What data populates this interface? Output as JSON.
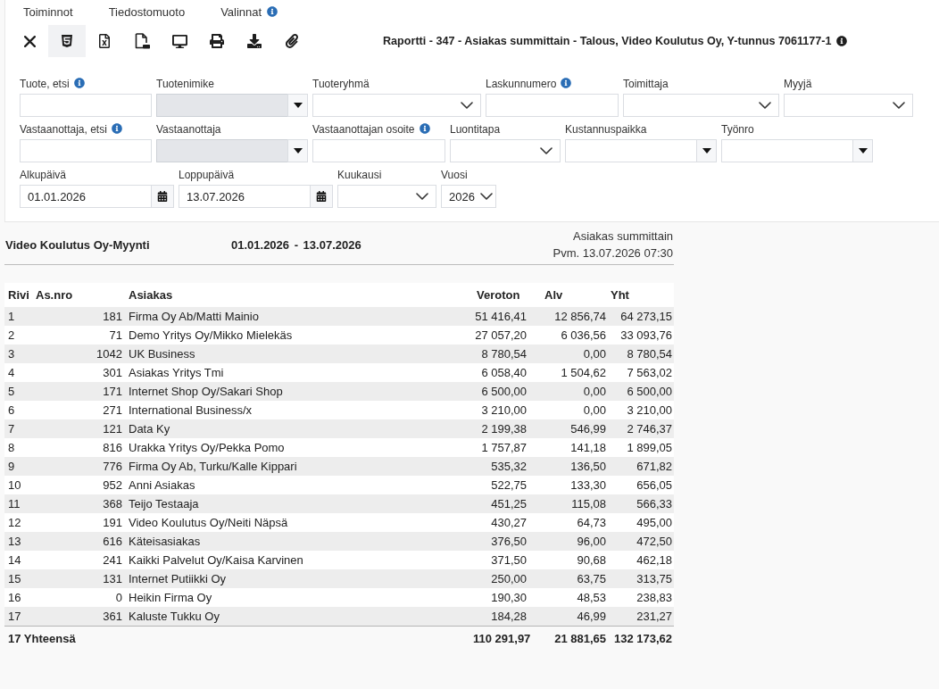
{
  "menu": [
    {
      "label": "Toiminnot",
      "info": false
    },
    {
      "label": "Tiedostomuoto",
      "info": false
    },
    {
      "label": "Valinnat",
      "info": true
    }
  ],
  "toolbar": [
    {
      "kind": "close",
      "selected": false
    },
    {
      "kind": "html",
      "selected": true
    },
    {
      "kind": "excel",
      "selected": false
    },
    {
      "kind": "pdf",
      "selected": false
    },
    {
      "kind": "screen",
      "selected": false
    },
    {
      "kind": "print",
      "selected": false
    },
    {
      "kind": "download",
      "selected": false
    },
    {
      "kind": "attach",
      "selected": false
    }
  ],
  "report_title": {
    "text": "Raportti - 347 - Asiakas summittain - Talous, Video Koulutus Oy, Y-tunnus 7061177-1",
    "info": true
  },
  "filters": [
    [
      {
        "label": "Tuote, etsi",
        "kind": "text",
        "info": true,
        "disabled": false
      },
      {
        "label": "Tuotenimike",
        "kind": "combo",
        "info": false,
        "disabled": true
      },
      {
        "label": "Tuoteryhmä",
        "kind": "select",
        "info": false,
        "disabled": false
      },
      {
        "label": "Laskunnumero",
        "kind": "text",
        "info": true,
        "disabled": false
      },
      {
        "label": "Toimittaja",
        "kind": "select",
        "info": false,
        "disabled": false
      },
      {
        "label": "Myyjä",
        "kind": "select",
        "info": false,
        "disabled": false
      }
    ],
    [
      {
        "label": "Vastaanottaja, etsi",
        "kind": "text",
        "info": true,
        "disabled": false
      },
      {
        "label": "Vastaanottaja",
        "kind": "combo",
        "info": false,
        "disabled": true
      },
      {
        "label": "Vastaanottajan osoite",
        "kind": "text",
        "info": true,
        "disabled": false
      },
      {
        "label": "Luontitapa",
        "kind": "select",
        "info": false,
        "disabled": false
      },
      {
        "label": "Kustannuspaikka",
        "kind": "combo",
        "info": false,
        "disabled": false
      },
      {
        "label": "Työnro",
        "kind": "combo",
        "info": false,
        "disabled": false
      }
    ],
    [
      {
        "label": "Alkupäivä",
        "kind": "date",
        "info": false,
        "disabled": false,
        "value": "01.01.2026"
      },
      {
        "label": "Loppupäivä",
        "kind": "date",
        "info": false,
        "disabled": false,
        "value": "13.07.2026"
      },
      {
        "label": "Kuukausi",
        "kind": "select",
        "info": false,
        "disabled": false
      },
      {
        "label": "Vuosi",
        "kind": "select",
        "info": false,
        "disabled": false,
        "value": "2026"
      }
    ]
  ],
  "report_header": {
    "company": "Video Koulutus Oy-Myynti",
    "period": "01.01.2026 - 13.07.2026",
    "report_type": "Asiakas summittain",
    "printed": "Pvm. 13.07.2026 07:30"
  },
  "table": {
    "columns": [
      "Rivi",
      "As.nro",
      "Asiakas",
      "Veroton",
      "Alv",
      "Yht"
    ],
    "rows": [
      [
        "1",
        "181",
        "Firma Oy Ab/Matti Mainio",
        "51 416,41",
        "12 856,74",
        "64 273,15"
      ],
      [
        "2",
        "71",
        "Demo Yritys Oy/Mikko Mielekäs",
        "27 057,20",
        "6 036,56",
        "33 093,76"
      ],
      [
        "3",
        "1042",
        "UK Business",
        "8 780,54",
        "0,00",
        "8 780,54"
      ],
      [
        "4",
        "301",
        "Asiakas Yritys Tmi",
        "6 058,40",
        "1 504,62",
        "7 563,02"
      ],
      [
        "5",
        "171",
        "Internet Shop Oy/Sakari Shop",
        "6 500,00",
        "0,00",
        "6 500,00"
      ],
      [
        "6",
        "271",
        "International Business/x",
        "3 210,00",
        "0,00",
        "3 210,00"
      ],
      [
        "7",
        "121",
        "Data Ky",
        "2 199,38",
        "546,99",
        "2 746,37"
      ],
      [
        "8",
        "816",
        "Urakka Yritys Oy/Pekka Pomo",
        "1 757,87",
        "141,18",
        "1 899,05"
      ],
      [
        "9",
        "776",
        "Firma Oy Ab, Turku/Kalle Kippari",
        "535,32",
        "136,50",
        "671,82"
      ],
      [
        "10",
        "952",
        "Anni Asiakas",
        "522,75",
        "133,30",
        "656,05"
      ],
      [
        "11",
        "368",
        "Teijo Testaaja",
        "451,25",
        "115,08",
        "566,33"
      ],
      [
        "12",
        "191",
        "Video Koulutus Oy/Neiti Näpsä",
        "430,27",
        "64,73",
        "495,00"
      ],
      [
        "13",
        "616",
        "Käteisasiakas",
        "376,50",
        "96,00",
        "472,50"
      ],
      [
        "14",
        "241",
        "Kaikki Palvelut Oy/Kaisa Karvinen",
        "371,50",
        "90,68",
        "462,18"
      ],
      [
        "15",
        "131",
        "Internet Putiikki Oy",
        "250,00",
        "63,75",
        "313,75"
      ],
      [
        "16",
        "0",
        "Heikin Firma Oy",
        "190,30",
        "48,53",
        "238,83"
      ],
      [
        "17",
        "361",
        "Kaluste Tukku Oy",
        "184,28",
        "46,99",
        "231,27"
      ]
    ],
    "total": {
      "label": "17 Yhteensä",
      "values": [
        "110 291,97",
        "21 881,65",
        "132 173,62"
      ]
    }
  }
}
